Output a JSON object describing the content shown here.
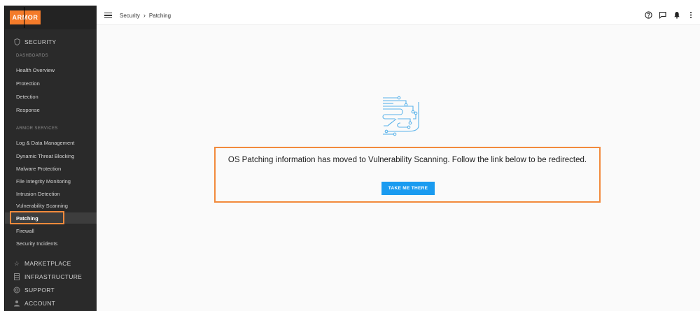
{
  "brand": {
    "logo_text": "ARMOR",
    "accent": "#f47b2a",
    "button_color": "#1a9bf0"
  },
  "topbar": {
    "breadcrumb": [
      "Security",
      "Patching"
    ],
    "icons": [
      "help-icon",
      "chat-icon",
      "bell-icon",
      "more-vert-icon"
    ]
  },
  "sidebar": {
    "security": "SECURITY",
    "dashboards_label": "DASHBOARDS",
    "dashboards": [
      "Health Overview",
      "Protection",
      "Detection",
      "Response"
    ],
    "services_label": "ARMOR SERVICES",
    "services": [
      "Log & Data Management",
      "Dynamic Threat Blocking",
      "Malware Protection",
      "File Integrity Monitoring",
      "Intrusion Detection",
      "Vulnerability Scanning",
      "Patching",
      "Firewall",
      "Security Incidents"
    ],
    "active_item": "Patching",
    "marketplace": "MARKETPLACE",
    "infrastructure": "INFRASTRUCTURE",
    "support": "SUPPORT",
    "account": "ACCOUNT"
  },
  "main": {
    "message": "OS Patching information has moved to Vulnerability Scanning. Follow the link below to be redirected.",
    "button_label": "TAKE ME THERE"
  }
}
